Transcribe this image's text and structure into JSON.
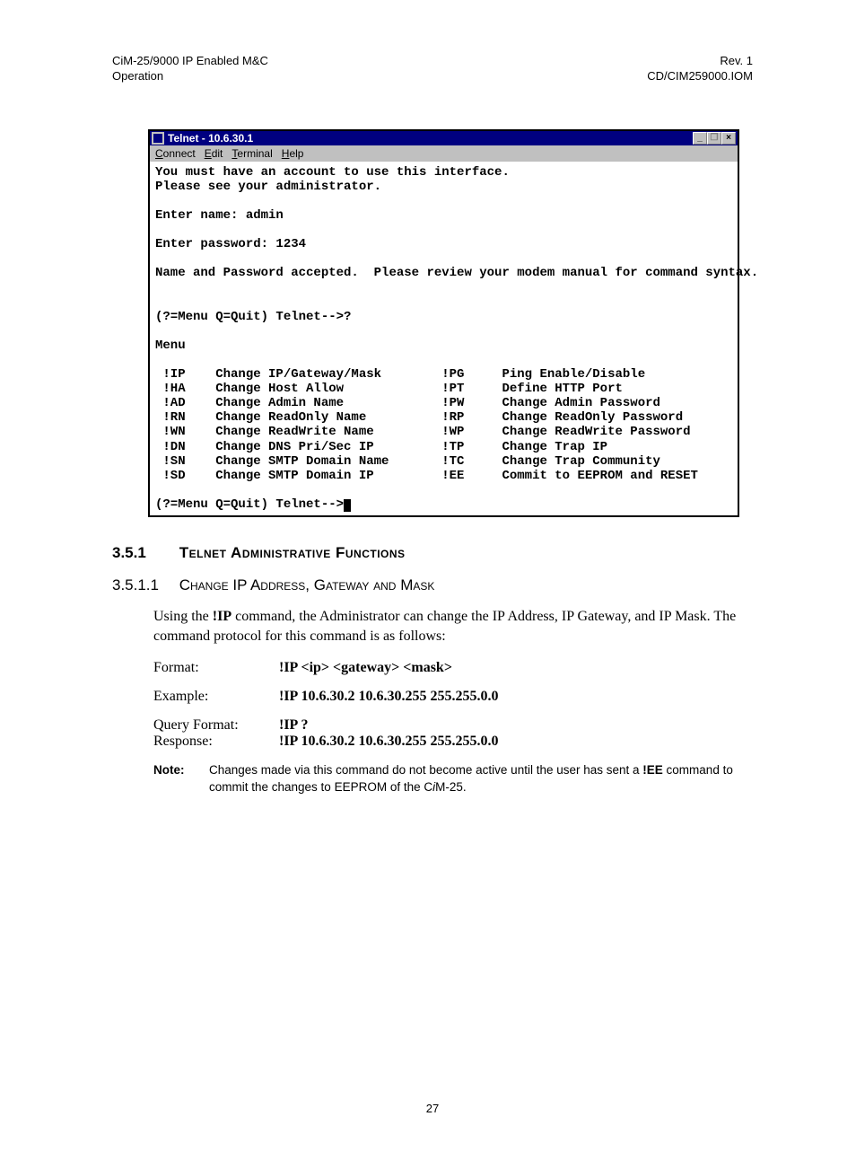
{
  "header": {
    "left_line1": "CiM-25/9000 IP Enabled M&C",
    "left_line2": "Operation",
    "right_line1": "Rev. 1",
    "right_line2": "CD/CIM259000.IOM"
  },
  "telnet": {
    "title": "Telnet - 10.6.30.1",
    "minimize": "_",
    "restore": "❐",
    "close": "×",
    "menu": {
      "connect": "Connect",
      "edit": "Edit",
      "terminal": "Terminal",
      "help": "Help"
    },
    "line1": "You must have an account to use this interface.",
    "line2": "Please see your administrator.",
    "line3": "Enter name: admin",
    "line4": "Enter password: 1234",
    "line5": "Name and Password accepted.  Please review your modem manual for command syntax.",
    "prompt1": "(?=Menu Q=Quit) Telnet-->?",
    "menu_label": "Menu",
    "menu_rows": [
      {
        "l_cmd": " !IP",
        "l_desc": "Change IP/Gateway/Mask",
        "r_cmd": "!PG",
        "r_desc": "Ping Enable/Disable"
      },
      {
        "l_cmd": " !HA",
        "l_desc": "Change Host Allow",
        "r_cmd": "!PT",
        "r_desc": "Define HTTP Port"
      },
      {
        "l_cmd": " !AD",
        "l_desc": "Change Admin Name",
        "r_cmd": "!PW",
        "r_desc": "Change Admin Password"
      },
      {
        "l_cmd": " !RN",
        "l_desc": "Change ReadOnly Name",
        "r_cmd": "!RP",
        "r_desc": "Change ReadOnly Password"
      },
      {
        "l_cmd": " !WN",
        "l_desc": "Change ReadWrite Name",
        "r_cmd": "!WP",
        "r_desc": "Change ReadWrite Password"
      },
      {
        "l_cmd": " !DN",
        "l_desc": "Change DNS Pri/Sec IP",
        "r_cmd": "!TP",
        "r_desc": "Change Trap IP"
      },
      {
        "l_cmd": " !SN",
        "l_desc": "Change SMTP Domain Name",
        "r_cmd": "!TC",
        "r_desc": "Change Trap Community"
      },
      {
        "l_cmd": " !SD",
        "l_desc": "Change SMTP Domain IP",
        "r_cmd": "!EE",
        "r_desc": "Commit to EEPROM and RESET"
      }
    ],
    "prompt2": "(?=Menu Q=Quit) Telnet-->"
  },
  "section_351": {
    "num": "3.5.1",
    "title": "Telnet Administrative Functions"
  },
  "section_3511": {
    "num": "3.5.1.1",
    "title": "Change IP Address, Gateway and Mask"
  },
  "body": {
    "para_pre": "Using the ",
    "cmd_ip": "!IP",
    "para_post": " command, the Administrator can change the IP Address, IP Gateway, and IP Mask.  The command protocol for this command is as follows:"
  },
  "cmds": {
    "format_label": "Format:",
    "format_value": "!IP <ip> <gateway> <mask>",
    "example_label": "Example:",
    "example_value": "!IP 10.6.30.2 10.6.30.255 255.255.0.0",
    "query_label": "Query Format:",
    "query_value": "!IP ?",
    "response_label": "Response:",
    "response_value": "!IP 10.6.30.2 10.6.30.255 255.255.0.0"
  },
  "note": {
    "label": "Note:",
    "text_pre": "Changes made via this command do not become active until the user has sent a ",
    "ee_cmd": "!EE",
    "text_mid": " command to commit the changes to EEPROM of the C",
    "italic_i": "i",
    "text_post": "M-25."
  },
  "page_number": "27"
}
